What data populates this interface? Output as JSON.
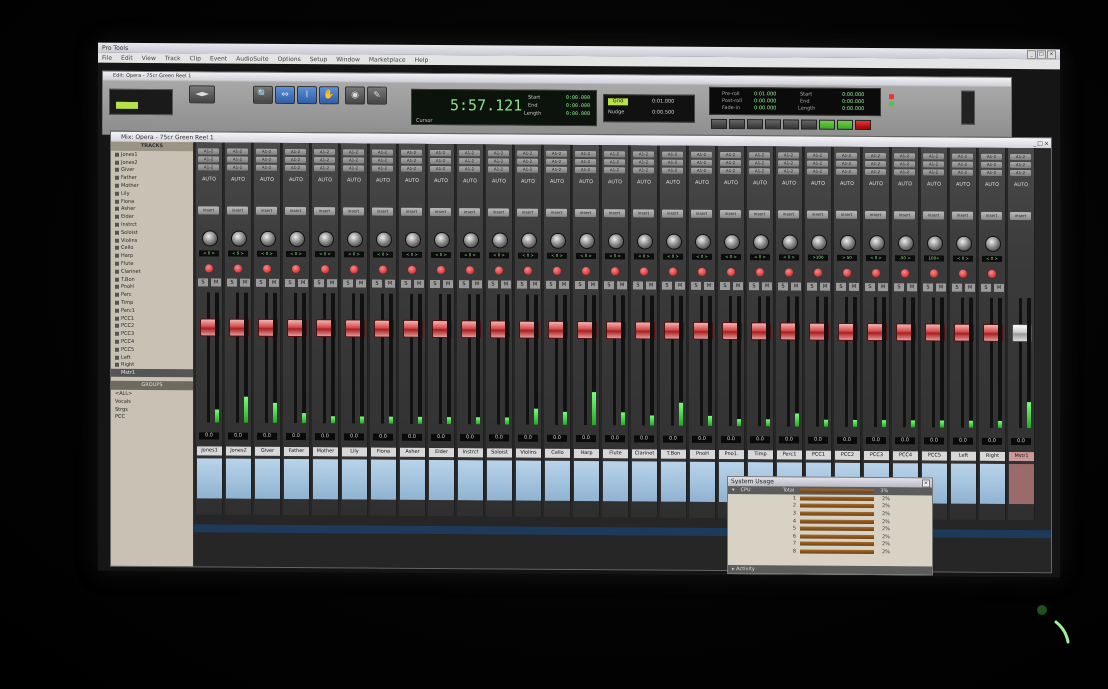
{
  "app": {
    "title": "Pro Tools",
    "menu": [
      "File",
      "Edit",
      "View",
      "Track",
      "Clip",
      "Event",
      "AudioSuite",
      "Options",
      "Setup",
      "Window",
      "Marketplace",
      "Help"
    ]
  },
  "transport_window": {
    "title": "Edit: Opera - 75cr Green Reel 1",
    "counter_main": "5:57.121",
    "start_label": "Start",
    "end_label": "End",
    "length_label": "Length",
    "start_val": "0:00.000",
    "end_val": "0:00.000",
    "length_val": "0:00.000",
    "cursor_label": "Cursor",
    "grid_label": "Grid",
    "nudge_label": "Nudge",
    "grid_val": "0:01.000",
    "nudge_val": "0:00.500",
    "pre_roll_label": "Pre-roll",
    "post_roll_label": "Post-roll",
    "fade_in_label": "Fade-in",
    "pre_val": "0:01.000",
    "post_val": "0:00.000",
    "fade_val": "0:00.000"
  },
  "mix_window": {
    "title": "Mix: Opera - 75cr Green Reel 1",
    "tracks_header": "TRACKS",
    "groups_header": "GROUPS",
    "track_list": [
      "Jones1",
      "Jones2",
      "Giver",
      "Father",
      "Mother",
      "Lily",
      "Fiona",
      "Asher",
      "Elder",
      "Instrct",
      "Soloist",
      "Violins",
      "Cello",
      "Harp",
      "Flute",
      "Clarinet",
      "T.Bon",
      "PnoH",
      "Perc",
      "Timp",
      "Perc1",
      "PCC1",
      "PCC2",
      "PCC3",
      "PCC4",
      "PCC5",
      "Left",
      "Right",
      "Mstr1"
    ],
    "group_list": [
      "<ALL>",
      "Vocals",
      "Strgs",
      "PCC"
    ],
    "io_label": "A1-2",
    "auto_label": "AUTO",
    "insert_label": "insert",
    "rec_label": "R",
    "solo_label": "S",
    "mute_label": "M",
    "strips": [
      {
        "name": "Jones1",
        "pan": "< 0 >",
        "vol": "0.0",
        "level": 0.1
      },
      {
        "name": "Jones2",
        "pan": "< 0 >",
        "vol": "0.0",
        "level": 0.2
      },
      {
        "name": "Giver",
        "pan": "< 0 >",
        "vol": "0.0",
        "level": 0.15
      },
      {
        "name": "Father",
        "pan": "< 0 >",
        "vol": "0.0",
        "level": 0.08
      },
      {
        "name": "Mother",
        "pan": "< 0 >",
        "vol": "0.0",
        "level": 0.05
      },
      {
        "name": "Lily",
        "pan": "< 0 >",
        "vol": "0.0",
        "level": 0.05
      },
      {
        "name": "Fiona",
        "pan": "< 0 >",
        "vol": "0.0",
        "level": 0.05
      },
      {
        "name": "Asher",
        "pan": "< 0 >",
        "vol": "0.0",
        "level": 0.05
      },
      {
        "name": "Elder",
        "pan": "< 0 >",
        "vol": "0.0",
        "level": 0.05
      },
      {
        "name": "Instrct",
        "pan": "< 0 >",
        "vol": "0.0",
        "level": 0.05
      },
      {
        "name": "Soloist",
        "pan": "< 0 >",
        "vol": "0.0",
        "level": 0.05
      },
      {
        "name": "Violins",
        "pan": "< 0 >",
        "vol": "0.0",
        "level": 0.12
      },
      {
        "name": "Cello",
        "pan": "< 0 >",
        "vol": "0.0",
        "level": 0.1
      },
      {
        "name": "Harp",
        "pan": "< 0 >",
        "vol": "0.0",
        "level": 0.25
      },
      {
        "name": "Flute",
        "pan": "< 0 >",
        "vol": "0.0",
        "level": 0.1
      },
      {
        "name": "Clarinet",
        "pan": "< 0 >",
        "vol": "0.0",
        "level": 0.08
      },
      {
        "name": "T.Bon",
        "pan": "< 0 >",
        "vol": "0.0",
        "level": 0.18
      },
      {
        "name": "PnoH",
        "pan": "< 0 >",
        "vol": "0.0",
        "level": 0.08
      },
      {
        "name": "Pno1.",
        "pan": "< 0 >",
        "vol": "0.0",
        "level": 0.05
      },
      {
        "name": "Timp",
        "pan": "< 0 >",
        "vol": "0.0",
        "level": 0.05
      },
      {
        "name": "Perc1",
        "pan": "< 0 >",
        "vol": "0.0",
        "level": 0.1
      },
      {
        "name": "PCC1",
        "pan": ">100",
        "vol": "0.0",
        "level": 0.05
      },
      {
        "name": "PCC2",
        "pan": "> 50",
        "vol": "0.0",
        "level": 0.05
      },
      {
        "name": "PCC3",
        "pan": "< 0 >",
        "vol": "0.0",
        "level": 0.05
      },
      {
        "name": "PCC4",
        "pan": "-50 <",
        "vol": "0.0",
        "level": 0.05
      },
      {
        "name": "PCC5",
        "pan": "100<",
        "vol": "0.0",
        "level": 0.05
      },
      {
        "name": "Left",
        "pan": "< 0 >",
        "vol": "0.0",
        "level": 0.05
      },
      {
        "name": "Right",
        "pan": "< 0 >",
        "vol": "0.0",
        "level": 0.05
      },
      {
        "name": "Mstr1",
        "pan": "",
        "vol": "0.0",
        "level": 0.2,
        "master": true
      }
    ]
  },
  "system_usage": {
    "title": "System Usage",
    "cpu_label": "CPU",
    "total_label": "Total",
    "total_val": "3%",
    "cores": [
      {
        "n": "1",
        "p": "2%"
      },
      {
        "n": "2",
        "p": "2%"
      },
      {
        "n": "3",
        "p": "2%"
      },
      {
        "n": "4",
        "p": "2%"
      },
      {
        "n": "5",
        "p": "2%"
      },
      {
        "n": "6",
        "p": "2%"
      },
      {
        "n": "7",
        "p": "2%"
      },
      {
        "n": "8",
        "p": "2%"
      }
    ],
    "activity_label": "Activity"
  },
  "colors": {
    "fader_red": "#d44a4a",
    "counter_green": "#8fe38f",
    "comment_blue": "#8fb3d2",
    "rec_red": "#cc1111"
  }
}
